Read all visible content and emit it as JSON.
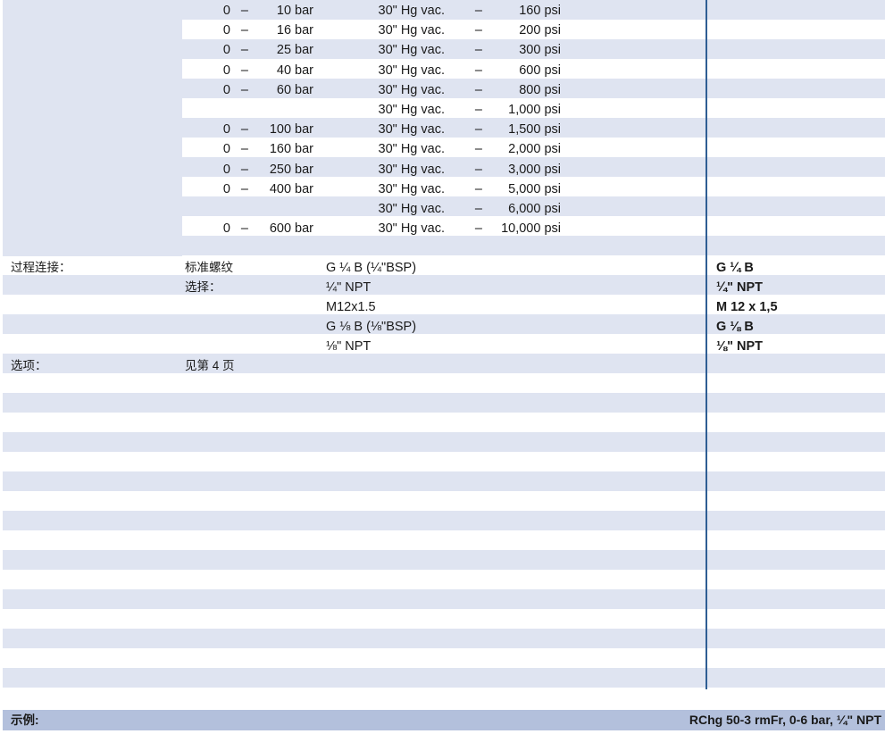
{
  "pressure_rows": [
    {
      "lo": "0",
      "dash": "–",
      "bar": "10 bar",
      "vac": "30\" Hg vac.",
      "dash2": "–",
      "psi": "160 psi"
    },
    {
      "lo": "0",
      "dash": "–",
      "bar": "16 bar",
      "vac": "30\" Hg vac.",
      "dash2": "–",
      "psi": "200 psi"
    },
    {
      "lo": "0",
      "dash": "–",
      "bar": "25 bar",
      "vac": "30\" Hg vac.",
      "dash2": "–",
      "psi": "300 psi"
    },
    {
      "lo": "0",
      "dash": "–",
      "bar": "40 bar",
      "vac": "30\" Hg vac.",
      "dash2": "–",
      "psi": "600 psi"
    },
    {
      "lo": "0",
      "dash": "–",
      "bar": "60 bar",
      "vac": "30\" Hg vac.",
      "dash2": "–",
      "psi": "800 psi"
    },
    {
      "lo": "",
      "dash": "",
      "bar": "",
      "vac": "30\" Hg vac.",
      "dash2": "–",
      "psi": "1,000 psi"
    },
    {
      "lo": "0",
      "dash": "–",
      "bar": "100 bar",
      "vac": "30\" Hg vac.",
      "dash2": "–",
      "psi": "1,500 psi"
    },
    {
      "lo": "0",
      "dash": "–",
      "bar": "160 bar",
      "vac": "30\" Hg vac.",
      "dash2": "–",
      "psi": "2,000 psi"
    },
    {
      "lo": "0",
      "dash": "–",
      "bar": "250 bar",
      "vac": "30\" Hg vac.",
      "dash2": "–",
      "psi": "3,000 psi"
    },
    {
      "lo": "0",
      "dash": "–",
      "bar": "400 bar",
      "vac": "30\" Hg vac.",
      "dash2": "–",
      "psi": "5,000 psi"
    },
    {
      "lo": "",
      "dash": "",
      "bar": "",
      "vac": "30\" Hg vac.",
      "dash2": "–",
      "psi": "6,000 psi"
    },
    {
      "lo": "0",
      "dash": "–",
      "bar": "600 bar",
      "vac": "30\" Hg vac.",
      "dash2": "–",
      "psi": "10,000 psi"
    }
  ],
  "process_connection": {
    "label": "过程连接：",
    "standard_label": "标准螺纹",
    "option_label": "选择：",
    "items": [
      {
        "desc": "G ¼ B (¼\"BSP)",
        "code": "G ¼ B"
      },
      {
        "desc": "¼\" NPT",
        "code": "¼\" NPT"
      },
      {
        "desc": "M12x1.5",
        "code": "M 12 x 1,5"
      },
      {
        "desc": "G ⅛ B (⅛\"BSP)",
        "code": "G ⅛ B"
      },
      {
        "desc": "⅛\" NPT",
        "code": "⅛\" NPT"
      }
    ]
  },
  "options": {
    "label": "选项：",
    "value": "见第 4 页"
  },
  "footer": {
    "label": "示例:",
    "example": "RChg 50-3 rmFr, 0-6 bar, ¼\" NPT"
  },
  "colors": {
    "row_shade": "#dfe4f1",
    "divider": "#2f5e94",
    "footer_bg": "#b3c0dc"
  }
}
